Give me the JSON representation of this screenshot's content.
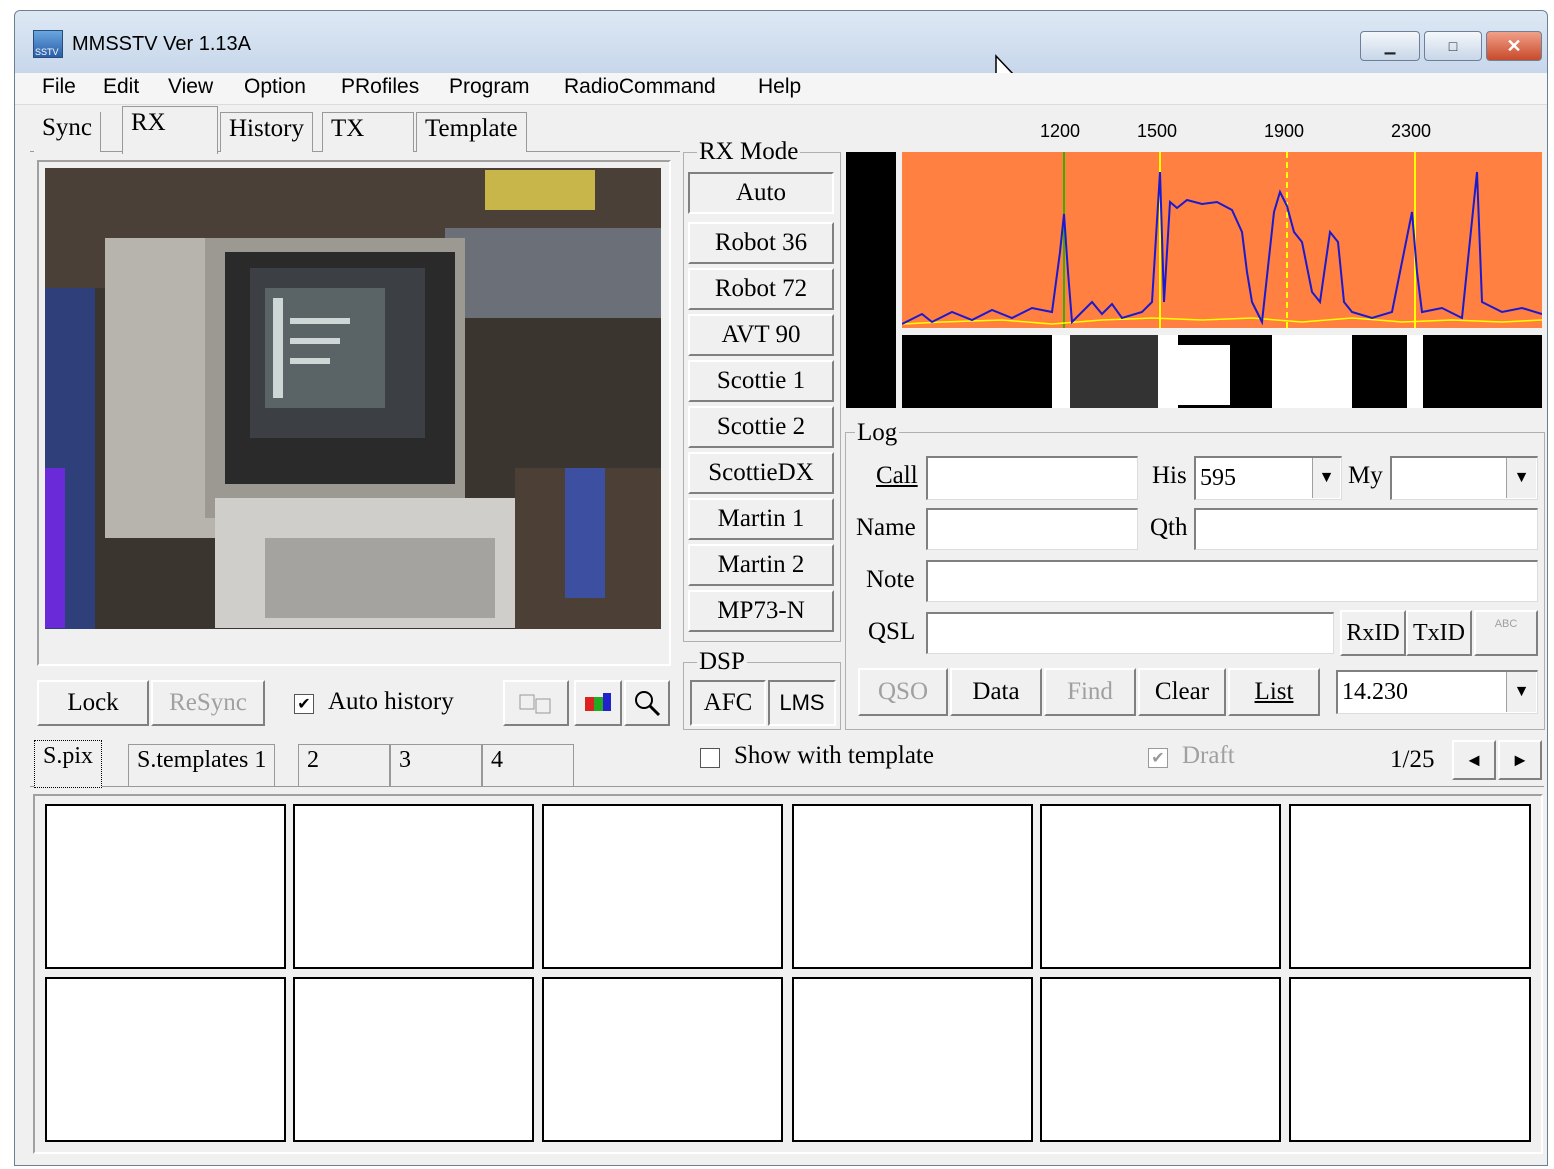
{
  "window": {
    "title": "MMSSTV Ver 1.13A",
    "app_icon_text": "SSTV"
  },
  "menu": [
    "File",
    "Edit",
    "View",
    "Option",
    "PRofiles",
    "Program",
    "RadioCommand",
    "Help"
  ],
  "top_tabs": [
    "Sync",
    "RX",
    "History",
    "TX",
    "Template"
  ],
  "rx_mode": {
    "label": "RX Mode",
    "modes": [
      "Auto",
      "Robot 36",
      "Robot 72",
      "AVT 90",
      "Scottie 1",
      "Scottie 2",
      "ScottieDX",
      "Martin 1",
      "Martin 2",
      "MP73-N"
    ]
  },
  "dsp": {
    "label": "DSP",
    "afc": "AFC",
    "lms": "LMS"
  },
  "spectrum": {
    "freq_labels": [
      "1200",
      "1500",
      "1900",
      "2300"
    ],
    "background": "#ff8040",
    "trace_color": "#1a1ad0"
  },
  "rx_controls": {
    "lock": "Lock",
    "resync": "ReSync",
    "auto_history": "Auto history",
    "auto_history_checked": "✔"
  },
  "log": {
    "label": "Log",
    "call_label": "Call",
    "his_label": "His",
    "his_value": "595",
    "my_label": "My",
    "name_label": "Name",
    "qth_label": "Qth",
    "note_label": "Note",
    "qsl_label": "QSL",
    "rxid": "RxID",
    "txid": "TxID",
    "abc": "ABC",
    "buttons": [
      "QSO",
      "Data",
      "Find",
      "Clear",
      "List"
    ],
    "freq_value": "14.230"
  },
  "bottom_tabs": [
    "S.pix",
    "S.templates 1",
    "2",
    "3",
    "4"
  ],
  "bottom_bar": {
    "show_with_template": "Show with template",
    "draft": "Draft",
    "draft_checked": "✔",
    "page": "1/25"
  },
  "icons": {
    "dropdown": "▼",
    "left": "◄",
    "right": "►",
    "minimize": "▁",
    "maximize": "□",
    "close": "✕"
  }
}
